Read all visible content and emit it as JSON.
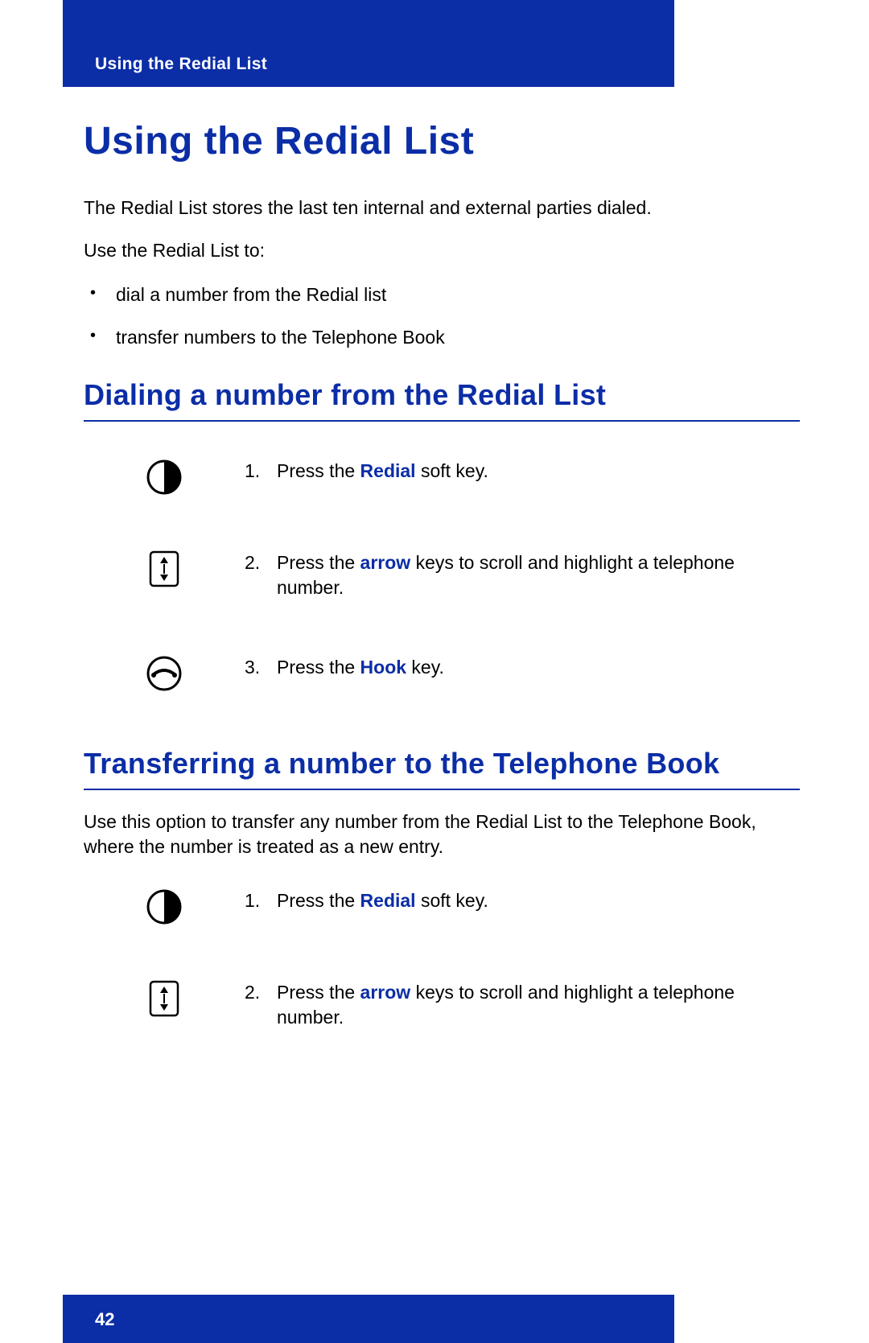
{
  "header": {
    "running_title": "Using the Redial List"
  },
  "title": "Using the Redial List",
  "intro1": "The Redial List stores the last ten internal and external parties dialed.",
  "intro2": "Use the Redial List to:",
  "bullets": {
    "b1": "dial a number from the Redial list",
    "b2": "transfer numbers to the Telephone Book"
  },
  "section1": {
    "heading": "Dialing a number from the Redial List",
    "step1_num": "1.",
    "step1_pre": "Press the ",
    "step1_kw": "Redial",
    "step1_post": " soft key.",
    "step2_num": "2.",
    "step2_pre": "Press the ",
    "step2_kw": "arrow",
    "step2_post": " keys to scroll and highlight a telephone number.",
    "step3_num": "3.",
    "step3_pre": "Press the ",
    "step3_kw": "Hook",
    "step3_post": " key."
  },
  "section2": {
    "heading": "Transferring a number to the Telephone Book",
    "intro": "Use this option to transfer any number from the Redial List to the Telephone Book, where the number is treated as a new entry.",
    "step1_num": "1.",
    "step1_pre": "Press the ",
    "step1_kw": "Redial",
    "step1_post": " soft key.",
    "step2_num": "2.",
    "step2_pre": "Press the ",
    "step2_kw": "arrow",
    "step2_post": " keys to scroll and highlight a telephone number."
  },
  "footer": {
    "page_number": "42"
  }
}
